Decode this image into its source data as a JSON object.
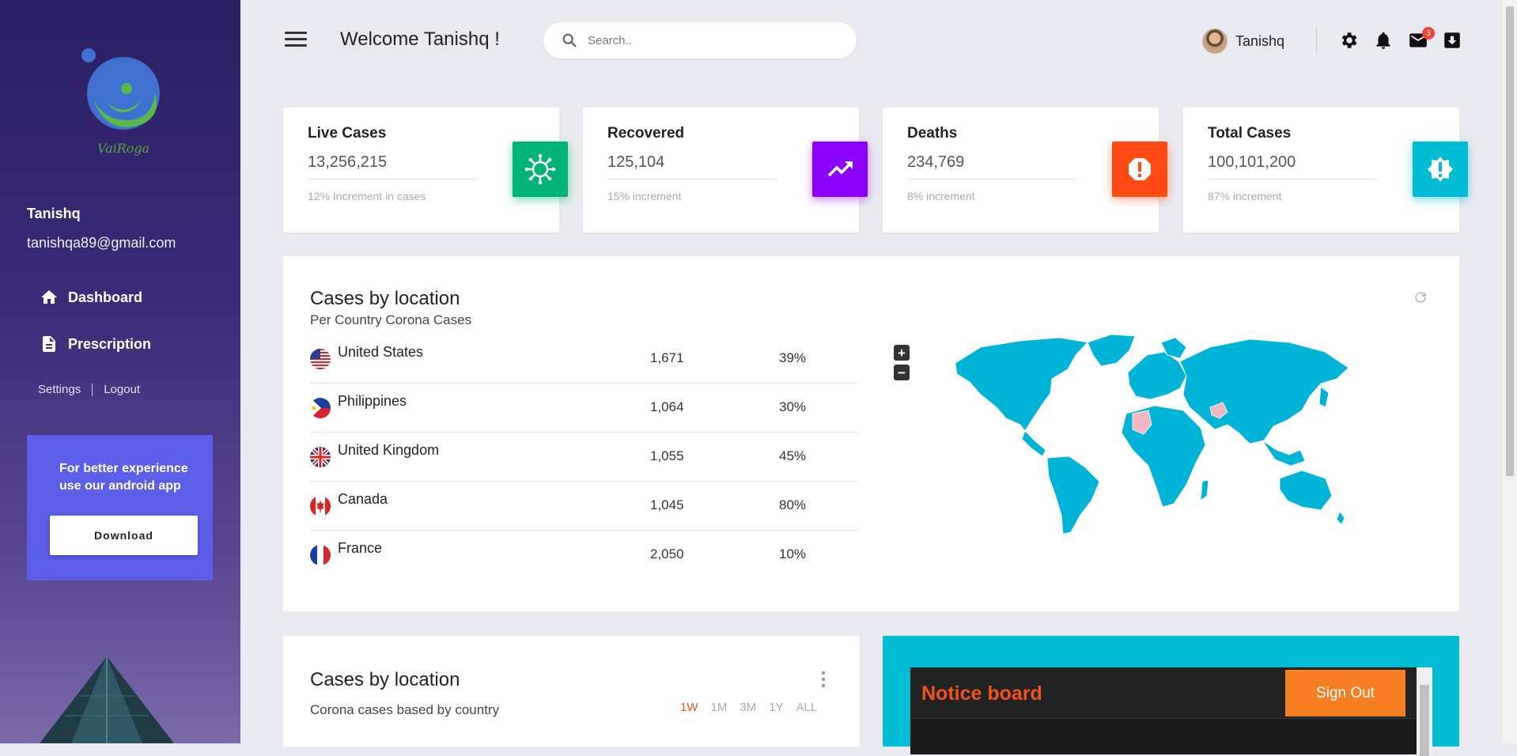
{
  "app": {
    "logo_text": "VaiRoga"
  },
  "sidebar": {
    "user_name": "Tanishq",
    "user_email": "tanishqa89@gmail.com",
    "nav": [
      {
        "label": "Dashboard",
        "icon": "home-icon"
      },
      {
        "label": "Prescription",
        "icon": "document-icon"
      }
    ],
    "settings_label": "Settings",
    "logout_label": "Logout",
    "promo_text": "For better experience use our android app",
    "promo_button": "Download"
  },
  "header": {
    "welcome": "Welcome Tanishq !",
    "search_placeholder": "Search..",
    "user_name": "Tanishq",
    "mail_badge": "3"
  },
  "stats": [
    {
      "title": "Live Cases",
      "value": "13,256,215",
      "note": "12% Increment in cases",
      "color": "#00b377",
      "icon": "virus-icon"
    },
    {
      "title": "Recovered",
      "value": "125,104",
      "note": "15% increment",
      "color": "#8b00ff",
      "icon": "trending-up-icon"
    },
    {
      "title": "Deaths",
      "value": "234,769",
      "note": "8% increment",
      "color": "#ff4a12",
      "icon": "alert-octagon-icon"
    },
    {
      "title": "Total Cases",
      "value": "100,101,200",
      "note": "87% increment",
      "color": "#00bcd4",
      "icon": "alert-badge-icon"
    }
  ],
  "locations": {
    "title": "Cases by location",
    "subtitle": "Per Country Corona Cases",
    "rows": [
      {
        "country": "United States",
        "count": "1,671",
        "percent": "39%"
      },
      {
        "country": "Philippines",
        "count": "1,064",
        "percent": "30%"
      },
      {
        "country": "United Kingdom",
        "count": "1,055",
        "percent": "45%"
      },
      {
        "country": "Canada",
        "count": "1,045",
        "percent": "80%"
      },
      {
        "country": "France",
        "count": "2,050",
        "percent": "10%"
      }
    ],
    "zoom_in": "+",
    "zoom_out": "−"
  },
  "chart_card": {
    "title": "Cases by location",
    "subtitle": "Corona cases based by country",
    "ranges": [
      "1W",
      "1M",
      "3M",
      "1Y",
      "ALL"
    ],
    "active_range": "1W"
  },
  "notice": {
    "title": "Notice board",
    "signout": "Sign Out"
  }
}
